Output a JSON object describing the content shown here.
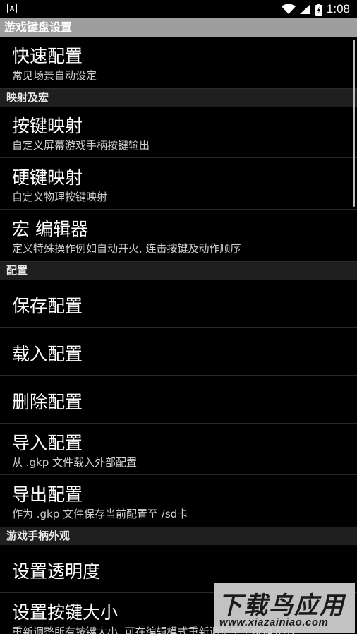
{
  "status_bar": {
    "app_icon_letter": "A",
    "time": "1:08"
  },
  "title": "游戏键盘设置",
  "groups": {
    "quick": {
      "title": "快速配置",
      "summary": "常见场景自动设定"
    },
    "mapping_section": "映射及宏",
    "key_mapping": {
      "title": "按键映射",
      "summary": "自定义屏幕游戏手柄按键输出"
    },
    "hard_key_mapping": {
      "title": "硬键映射",
      "summary": "自定义物理按键映射"
    },
    "macro_editor": {
      "title": "宏 编辑器",
      "summary": "定义特殊操作例如自动开火, 连击按键及动作顺序"
    },
    "config_section": "配置",
    "save_config": {
      "title": "保存配置"
    },
    "load_config": {
      "title": "载入配置"
    },
    "delete_config": {
      "title": "删除配置"
    },
    "import_config": {
      "title": "导入配置",
      "summary": "从 .gkp 文件载入外部配置"
    },
    "export_config": {
      "title": "导出配置",
      "summary": "作为 .gkp 文件保存当前配置至 /sd卡"
    },
    "appearance_section": "游戏手柄外观",
    "set_transparency": {
      "title": "设置透明度"
    },
    "set_key_size": {
      "title": "设置按键大小",
      "summary": "重新调整所有按键大小, 可在编辑模式重新调整单个按键大小"
    }
  },
  "watermark": {
    "main": "下载鸟应用",
    "url": "www.xiazainiao.com"
  }
}
